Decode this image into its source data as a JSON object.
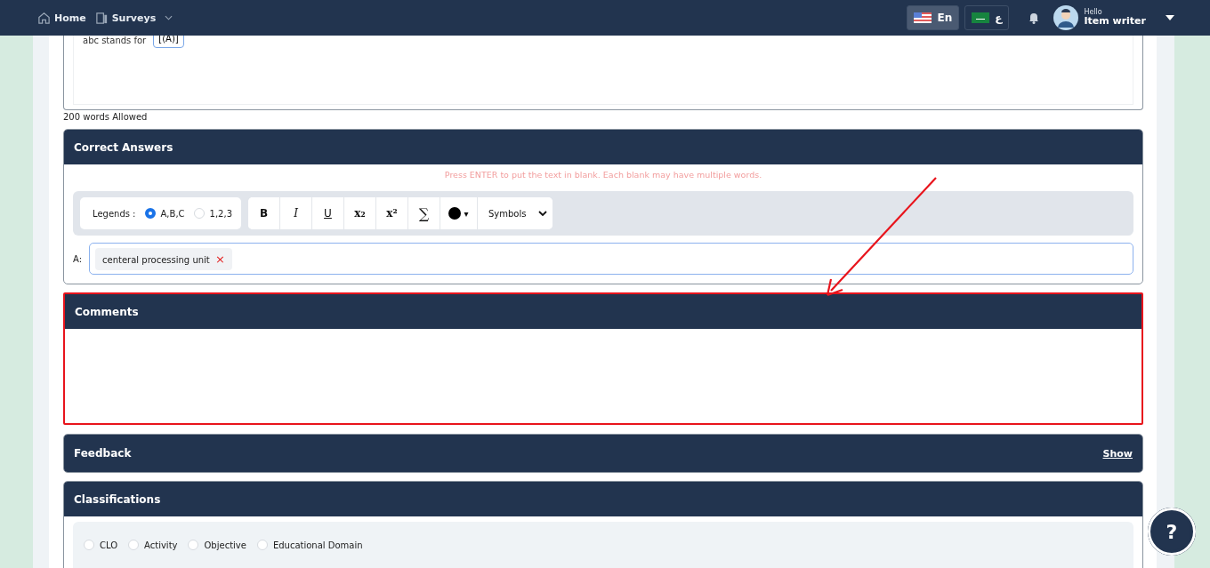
{
  "nav": {
    "items": [
      {
        "label": "Home",
        "kind": "home",
        "dropdown": false
      },
      {
        "label": "Surveys",
        "kind": "book",
        "dropdown": true
      }
    ],
    "languages": [
      {
        "label": "En",
        "kind": "us",
        "selected": true
      },
      {
        "label": "ع",
        "kind": "sa",
        "selected": false
      }
    ],
    "greeting": "Hello",
    "user": "Item writer"
  },
  "question": {
    "text": "abc stands for",
    "blank": "[(A)]",
    "limit": "200 words Allowed"
  },
  "correct_answers": {
    "title": "Correct Answers",
    "hint": "Press ENTER to put the text in blank. Each blank may have multiple words.",
    "legends_label": "Legends :",
    "legends": [
      {
        "label": "A,B,C",
        "selected": true
      },
      {
        "label": "1,2,3",
        "selected": false
      }
    ],
    "tools": [
      {
        "label": "B",
        "kind": "bold"
      },
      {
        "label": "I",
        "kind": "italic"
      },
      {
        "label": "U",
        "kind": "underline"
      },
      {
        "label": "x₂",
        "kind": "sub"
      },
      {
        "label": "x²",
        "kind": "sup"
      },
      {
        "label": "∑",
        "kind": "plain"
      }
    ],
    "color_button": "▾",
    "symbols": "Symbols",
    "answers": [
      {
        "letter": "A:",
        "tags": [
          "centeral processing unit"
        ]
      }
    ],
    "remove": "×"
  },
  "comments": {
    "title": "Comments",
    "highlighted": true
  },
  "feedback": {
    "title": "Feedback",
    "toggle": "Show"
  },
  "classifications": {
    "title": "Classifications",
    "options": [
      {
        "label": "CLO",
        "selected": false
      },
      {
        "label": "Activity",
        "selected": false
      },
      {
        "label": "Objective",
        "selected": false
      },
      {
        "label": "Educational Domain",
        "selected": false
      }
    ]
  },
  "help": "?"
}
